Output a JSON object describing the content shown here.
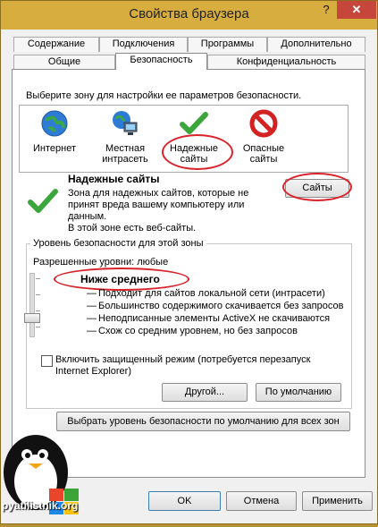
{
  "window": {
    "title": "Свойства браузера",
    "help": "?",
    "close": "✕"
  },
  "tabs_back": [
    "Содержание",
    "Подключения",
    "Программы",
    "Дополнительно"
  ],
  "tabs_front": [
    "Общие",
    "Безопасность",
    "Конфиденциальность"
  ],
  "security": {
    "prompt": "Выберите зону для настройки ее параметров безопасности.",
    "zones": [
      {
        "label_1": "Интернет",
        "label_2": "",
        "icon": "globe-icon"
      },
      {
        "label_1": "Местная",
        "label_2": "интрасеть",
        "icon": "intranet-icon"
      },
      {
        "label_1": "Надежные",
        "label_2": "сайты",
        "icon": "checkmark-icon"
      },
      {
        "label_1": "Опасные",
        "label_2": "сайты",
        "icon": "restricted-icon"
      }
    ],
    "zone_title": "Надежные сайты",
    "zone_desc_1": "Зона для надежных сайтов, которые не",
    "zone_desc_2": "принят вреда вашему компьютеру или",
    "zone_desc_3": "данным.",
    "zone_desc_4": "В этой зоне есть веб-сайты.",
    "sites_button": "Сайты",
    "group_title": "Уровень безопасности для этой зоны",
    "allowed_levels": "Разрешенные уровни: любые",
    "level_name": "Ниже среднего",
    "level_bullets": [
      "Подходит для сайтов локальной сети (интрасети)",
      "Большинство содержимого скачивается без запросов",
      "Неподписанные элементы ActiveX не скачиваются",
      "Схож со средним уровнем, но без запросов"
    ],
    "slider_level": 0.35,
    "protected_mode_1": "Включить защищенный режим (потребуется перезапуск",
    "protected_mode_2": "Internet Explorer)",
    "protected_mode_checked": false,
    "other_button": "Другой...",
    "default_button": "По умолчанию",
    "reset_all_button": "Выбрать уровень безопасности по умолчанию для всех зон"
  },
  "footer": {
    "ok": "OK",
    "cancel": "Отмена",
    "apply": "Применить"
  },
  "watermark": {
    "text": "pyatilistnik.org"
  },
  "colors": {
    "accent_frame": "#d6ad3e",
    "close_red": "#c7463c",
    "highlight_ellipse": "#d8232a"
  }
}
